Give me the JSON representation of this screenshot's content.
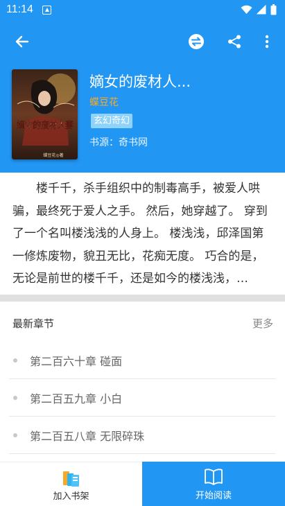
{
  "status_bar": {
    "time": "11:14",
    "icons": [
      "notification-icon",
      "wifi-icon",
      "signal-icon",
      "battery-icon"
    ]
  },
  "toolbar": {
    "back_icon": "arrow-back-icon",
    "switch_source_icon": "swap-source-icon",
    "share_icon": "share-icon",
    "more_icon": "more-vert-icon"
  },
  "book": {
    "title": "嫡女的废材人...",
    "author": "蝶豆花",
    "tag": "玄幻奇幻",
    "source": "书源：奇书网",
    "cover_text": "嫡女的废材人妻",
    "cover_author": "蝶豆花◎著",
    "intro": "楼千千，杀手组织中的制毒高手，被爱人哄骗，最终死于爱人之手。 然后，她穿越了。 穿到了一个名叫楼浅浅的人身上。 楼浅浅，邱泽国第一修炼废物，貌丑无比，花痴无度。 巧合的是，无论是前世的楼千千，还是如今的楼浅浅，都……"
  },
  "chapters_section": {
    "title": "最新章节",
    "more": "更多",
    "items": [
      {
        "label": "第二百六十章 碰面"
      },
      {
        "label": "第二百五九章 小白"
      },
      {
        "label": "第二百五八章 无限碎珠"
      }
    ]
  },
  "bottom_bar": {
    "add_shelf": "加入书架",
    "start_read": "开始阅读"
  },
  "colors": {
    "primary": "#2196f3",
    "author": "#ffa726",
    "tag_bg": "#8fd3fb"
  }
}
